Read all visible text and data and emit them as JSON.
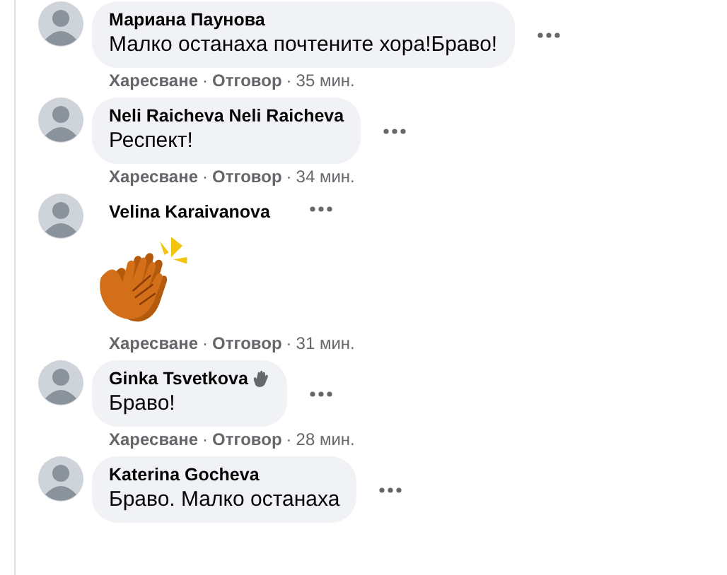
{
  "comments": [
    {
      "kind": "text",
      "author": "Мариана Паунова",
      "text": "Малко останаха почтените хора!Браво!",
      "actions": [
        {
          "kind": "link",
          "text": "Харесване"
        },
        {
          "kind": "dot",
          "text": "·"
        },
        {
          "kind": "link",
          "text": "Отговор"
        },
        {
          "kind": "dot",
          "text": "·"
        },
        {
          "kind": "time",
          "text": "35 мин."
        }
      ]
    },
    {
      "kind": "text",
      "author": "Neli Raicheva Neli Raicheva",
      "text": "Респект!",
      "actions": [
        {
          "kind": "link",
          "text": "Харесване"
        },
        {
          "kind": "dot",
          "text": "·"
        },
        {
          "kind": "link",
          "text": "Отговор"
        },
        {
          "kind": "dot",
          "text": "·"
        },
        {
          "kind": "time",
          "text": "34 мин."
        }
      ]
    },
    {
      "kind": "sticker",
      "author": "Velina Karaivanova",
      "actions": [
        {
          "kind": "link",
          "text": "Харесване"
        },
        {
          "kind": "dot",
          "text": "·"
        },
        {
          "kind": "link",
          "text": "Отговор"
        },
        {
          "kind": "dot",
          "text": "·"
        },
        {
          "kind": "time",
          "text": "31 мин."
        }
      ]
    },
    {
      "kind": "text",
      "author": "Ginka Tsvetkova",
      "badge": true,
      "text": "Браво!",
      "actions": [
        {
          "kind": "link",
          "text": "Харесване"
        },
        {
          "kind": "dot",
          "text": "·"
        },
        {
          "kind": "link",
          "text": "Отговор"
        },
        {
          "kind": "dot",
          "text": "·"
        },
        {
          "kind": "time",
          "text": "28 мин."
        }
      ]
    },
    {
      "kind": "text",
      "author": "Katerina Gocheva",
      "text": "Браво. Малко останаха"
    }
  ]
}
